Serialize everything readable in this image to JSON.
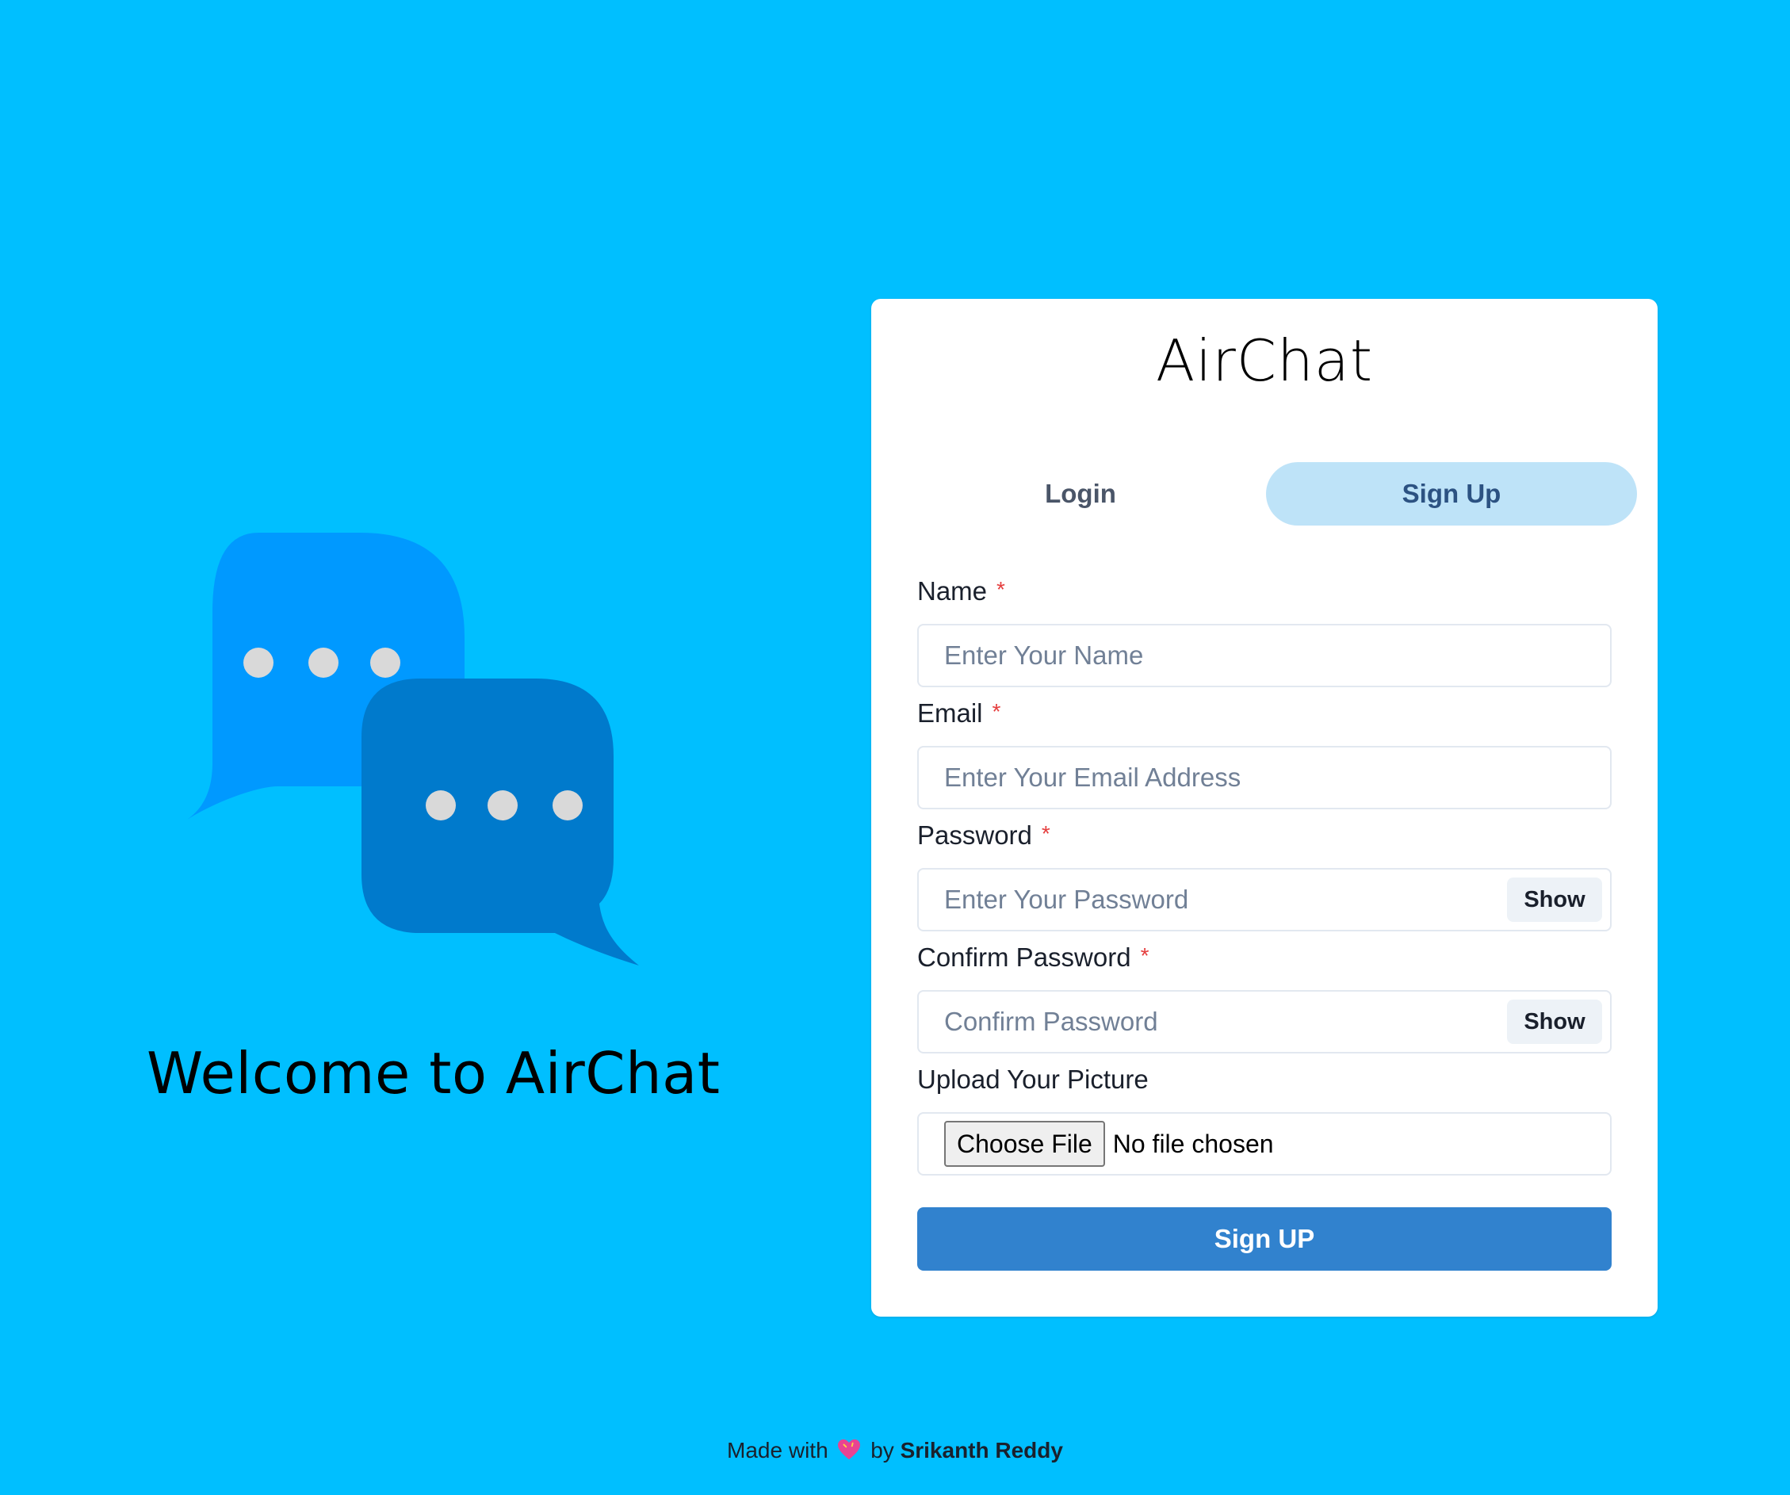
{
  "app": {
    "title": "AirChat",
    "welcome": "Welcome to AirChat"
  },
  "tabs": [
    {
      "label": "Login",
      "active": false
    },
    {
      "label": "Sign Up",
      "active": true
    }
  ],
  "form": {
    "name": {
      "label": "Name",
      "required": "*",
      "placeholder": "Enter Your Name",
      "value": ""
    },
    "email": {
      "label": "Email",
      "required": "*",
      "placeholder": "Enter Your Email Address",
      "value": ""
    },
    "password": {
      "label": "Password",
      "required": "*",
      "placeholder": "Enter Your Password",
      "value": "",
      "toggle": "Show"
    },
    "confirm": {
      "label": "Confirm Password",
      "required": "*",
      "placeholder": "Confirm Password",
      "value": "",
      "toggle": "Show"
    },
    "picture": {
      "label": "Upload Your Picture",
      "button": "Choose File",
      "status": "No file chosen"
    },
    "submit": "Sign UP"
  },
  "footer": {
    "prefix": "Made with",
    "by": "by",
    "author": "Srikanth Reddy",
    "icon": "heart-icon"
  },
  "colors": {
    "background": "#00BFFF",
    "bubble_back": "#0099FF",
    "bubble_front": "#007ACC",
    "dots": "#D9D9D9",
    "tab_active_bg": "#BEE3F8",
    "submit_bg": "#3182CE",
    "required": "#E53E3E"
  }
}
